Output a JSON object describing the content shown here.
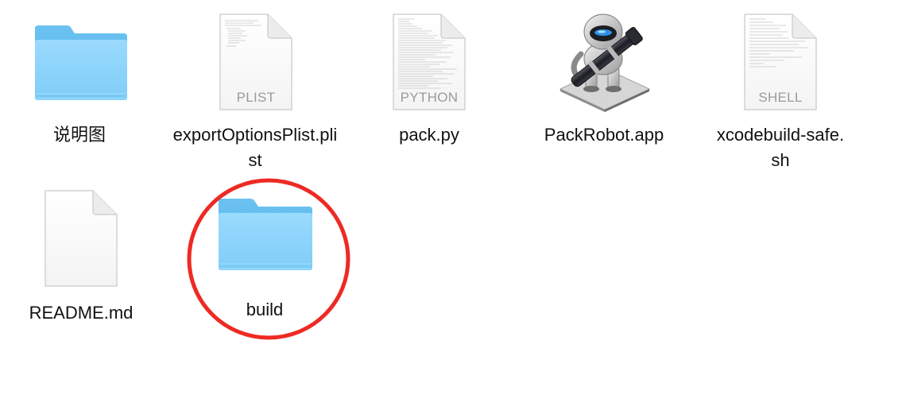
{
  "files": [
    {
      "label": "说明图",
      "type": "folder",
      "icon": "folder-icon"
    },
    {
      "label": "exportOptionsPlist.plist",
      "type": "document",
      "icon": "plist-document-icon",
      "badge": "PLIST"
    },
    {
      "label": "pack.py",
      "type": "document",
      "icon": "python-document-icon",
      "badge": "PYTHON"
    },
    {
      "label": "PackRobot.app",
      "type": "application",
      "icon": "automator-robot-icon"
    },
    {
      "label": "xcodebuild-safe.sh",
      "type": "document",
      "icon": "shell-document-icon",
      "badge": "SHELL"
    },
    {
      "label": "README.md",
      "type": "document",
      "icon": "blank-document-icon"
    },
    {
      "label": "build",
      "type": "folder",
      "icon": "folder-icon",
      "highlighted": true
    }
  ],
  "colors": {
    "folder_back": "#5bb8ee",
    "folder_front": "#8fd4fb",
    "highlight_circle": "#ee2a24"
  }
}
